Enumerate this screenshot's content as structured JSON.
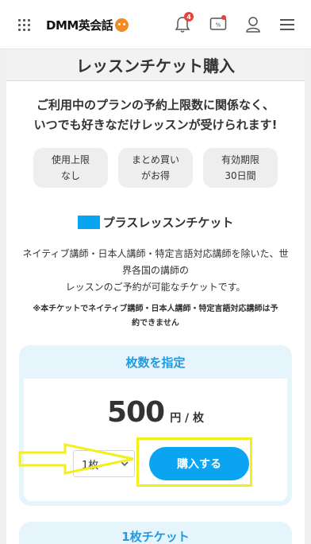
{
  "header": {
    "logo_text": "DMM英会話",
    "notification_count": "4",
    "ticket_icon_text": "%"
  },
  "page": {
    "title": "レッスンチケット購入",
    "lead_line1": "ご利用中のプランの予約上限数に関係なく、",
    "lead_line2": "いつでも好きなだけレッスンが受けられます!",
    "features": [
      {
        "line1": "使用上限",
        "line2": "なし"
      },
      {
        "line1": "まとめ買い",
        "line2": "がお得"
      },
      {
        "line1": "有効期限",
        "line2": "30日間"
      }
    ],
    "ticket_title": "プラスレッスンチケット",
    "desc_line1": "ネイティブ講師・日本人講師・特定言語対応講師を除いた、世",
    "desc_line2": "界各国の講師の",
    "desc_line3": "レッスンのご予約が可能なチケットです。",
    "note_line1": "※本チケットでネイティブ講師・日本人講師・特定言語対応講師は予",
    "note_line2": "約できません"
  },
  "purchase": {
    "heading": "枚数を指定",
    "price": "500",
    "price_unit": "円 / 枚",
    "quantity": "1枚",
    "buy_label": "購入する"
  },
  "next_section": {
    "heading": "1枚チケット"
  },
  "colors": {
    "accent": "#0aa4f0",
    "heading_blue": "#1e9be0",
    "highlight": "#f3ef1a",
    "badge": "#e8423a"
  }
}
